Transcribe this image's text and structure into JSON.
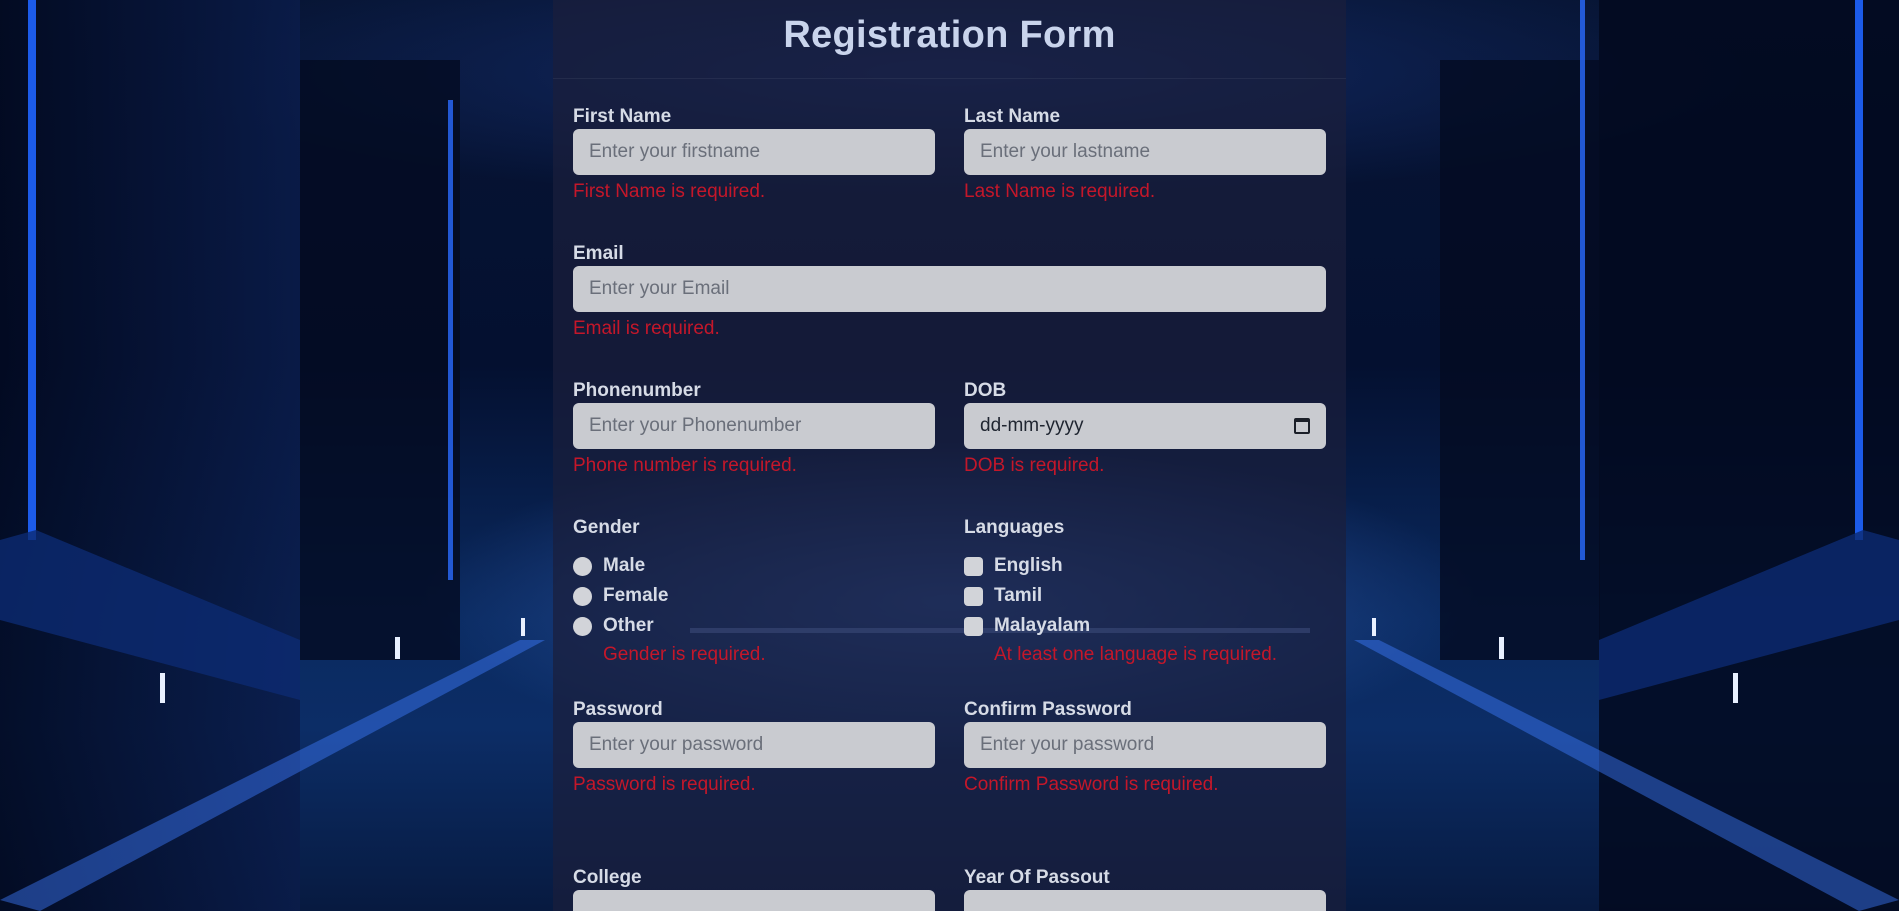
{
  "form": {
    "title": "Registration Form",
    "first_name": {
      "label": "First Name",
      "placeholder": "Enter your firstname",
      "error": "First Name is required."
    },
    "last_name": {
      "label": "Last Name",
      "placeholder": "Enter your lastname",
      "error": "Last Name is required."
    },
    "email": {
      "label": "Email",
      "placeholder": "Enter your Email",
      "error": "Email is required."
    },
    "phone": {
      "label": "Phonenumber",
      "placeholder": "Enter your Phonenumber",
      "error": "Phone number is required."
    },
    "dob": {
      "label": "DOB",
      "value": "dd-mm-yyyy",
      "error": "DOB is required."
    },
    "gender": {
      "label": "Gender",
      "options": [
        "Male",
        "Female",
        "Other"
      ],
      "error": "Gender is required."
    },
    "languages": {
      "label": "Languages",
      "options": [
        "English",
        "Tamil",
        "Malayalam"
      ],
      "error": "At least one language is required."
    },
    "password": {
      "label": "Password",
      "placeholder": "Enter your password",
      "error": "Password is required."
    },
    "confirm_password": {
      "label": "Confirm Password",
      "placeholder": "Enter your password",
      "error": "Confirm Password is required."
    },
    "college": {
      "label": "College"
    },
    "year_of_passout": {
      "label": "Year Of Passout"
    }
  }
}
